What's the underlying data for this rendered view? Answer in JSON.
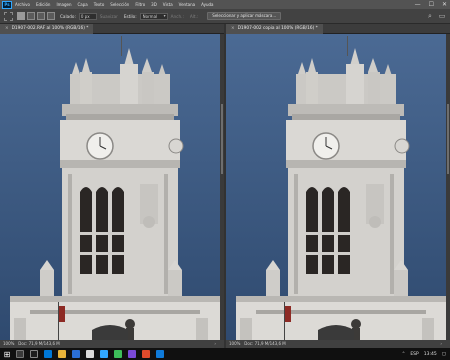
{
  "menubar": {
    "items": [
      "Archivo",
      "Edición",
      "Imagen",
      "Capa",
      "Texto",
      "Selección",
      "Filtro",
      "3D",
      "Vista",
      "Ventana",
      "Ayuda"
    ],
    "window_controls": [
      "—",
      "☐",
      "✕"
    ]
  },
  "options_bar": {
    "feather_label": "Calado:",
    "feather_value": "0 px",
    "antialias_label": "Suavizar",
    "style_label": "Estilo:",
    "style_value": "Normal",
    "width_label": "Anch.:",
    "height_label": "Alt.:",
    "select_mask_button": "Seleccionar y aplicar máscara..."
  },
  "documents": [
    {
      "tab_title": "D1907-002.RAF al 100% (RGB/16) *",
      "zoom": "100%",
      "status": "Doc: 71,9 M/143,6 M"
    },
    {
      "tab_title": "D1907-002 copia al 100% (RGB/16) *",
      "zoom": "100%",
      "status": "Doc: 71,9 M/143,6 M"
    }
  ],
  "taskbar": {
    "language": "ESP",
    "time": "13:45"
  },
  "colors": {
    "sky_top": "#4a6892",
    "sky_bottom": "#355176",
    "stone": "#d8d6d2",
    "stone_shadow": "#a9a7a3"
  }
}
